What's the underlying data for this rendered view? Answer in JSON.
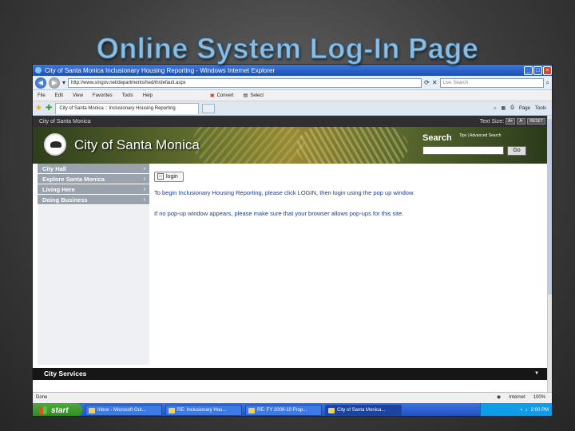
{
  "slide": {
    "title": "Online System Log-In Page"
  },
  "browser": {
    "window_title": "City of Santa Monica Inclusionary Housing Reporting - Windows Internet Explorer",
    "address": "http://www.smgov.net/departments/hed/ih/default.aspx",
    "search_placeholder": "Live Search",
    "menu": [
      "File",
      "Edit",
      "View",
      "Favorites",
      "Tools",
      "Help"
    ],
    "toolbar_extra": [
      "Convert",
      "Select"
    ],
    "tab_title": "City of Santa Monica :: Inclusionary Housing Reporting",
    "commands": [
      "Page",
      "Tools"
    ]
  },
  "site": {
    "top_label": "City of Santa Monica",
    "text_size_label": "Text Size:",
    "text_size_buttons": [
      "A+",
      "A-",
      "RESET"
    ],
    "logo_text": "City of Santa Monica",
    "search_label": "Search",
    "advanced_search": "Tips | Advanced Search",
    "go_label": "Go",
    "nav": [
      "City Hall",
      "Explore Santa Monica",
      "Living Here",
      "Doing Business"
    ],
    "login_label": "login",
    "instruction1": "To begin Inclusionary Housing Reporting, please click LOGIN, then login using the pop up window.",
    "instruction2": "If no pop-up window appears, please make sure that your browser allows pop-ups for this site.",
    "footer": "City Services"
  },
  "status": {
    "left": "Done",
    "zone": "Internet",
    "zoom": "100%"
  },
  "taskbar": {
    "start": "start",
    "tasks": [
      "Inbox - Microsoft Out...",
      "RE: Inclusionary Hou...",
      "RE: FY 2009-10 Prop...",
      "City of Santa Monica..."
    ],
    "clock": "2:00 PM"
  }
}
